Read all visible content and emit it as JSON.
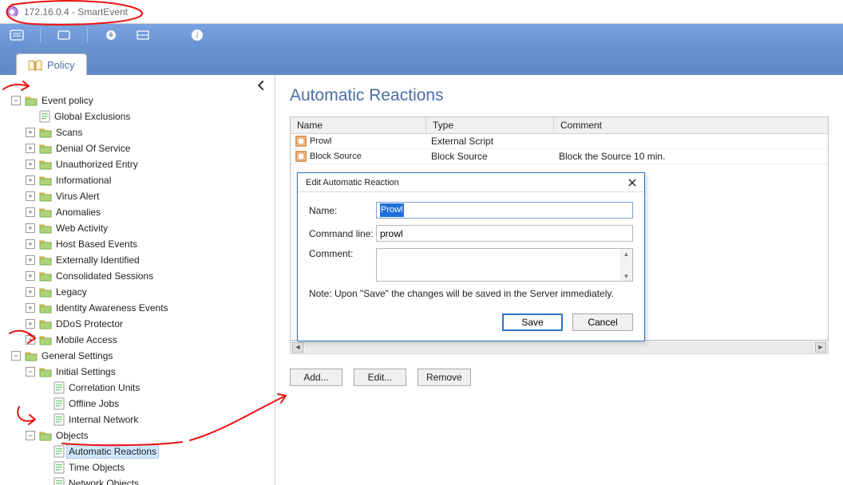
{
  "window": {
    "title": "172.16.0.4 - SmartEvent"
  },
  "tab": {
    "label": "Policy"
  },
  "tree": {
    "root": "Event policy",
    "items": [
      {
        "label": "Global Exclusions",
        "type": "doc"
      },
      {
        "label": "Scans",
        "type": "folder",
        "toggle": "+"
      },
      {
        "label": "Denial Of Service",
        "type": "folder",
        "toggle": "+"
      },
      {
        "label": "Unauthorized Entry",
        "type": "folder",
        "toggle": "+"
      },
      {
        "label": "Informational",
        "type": "folder",
        "toggle": "+"
      },
      {
        "label": "Virus Alert",
        "type": "folder",
        "toggle": "+"
      },
      {
        "label": "Anomalies",
        "type": "folder",
        "toggle": "+"
      },
      {
        "label": "Web Activity",
        "type": "folder",
        "toggle": "+"
      },
      {
        "label": "Host Based Events",
        "type": "folder",
        "toggle": "+"
      },
      {
        "label": "Externally Identified",
        "type": "folder",
        "toggle": "+"
      },
      {
        "label": "Consolidated Sessions",
        "type": "folder",
        "toggle": "+"
      },
      {
        "label": "Legacy",
        "type": "folder",
        "toggle": "+"
      },
      {
        "label": "Identity Awareness Events",
        "type": "folder",
        "toggle": "+"
      },
      {
        "label": "DDoS Protector",
        "type": "folder",
        "toggle": "+"
      },
      {
        "label": "Mobile Access",
        "type": "folder",
        "toggle": "+"
      }
    ],
    "general": "General Settings",
    "initial": "Initial Settings",
    "initial_children": [
      {
        "label": "Correlation Units"
      },
      {
        "label": "Offline Jobs"
      },
      {
        "label": "Internal Network"
      }
    ],
    "objects": "Objects",
    "objects_children": [
      {
        "label": "Automatic Reactions",
        "selected": true
      },
      {
        "label": "Time Objects"
      },
      {
        "label": "Network Objects"
      }
    ]
  },
  "page": {
    "title": "Automatic Reactions"
  },
  "grid": {
    "headers": {
      "name": "Name",
      "type": "Type",
      "comment": "Comment"
    },
    "rows": [
      {
        "name": "Prowl",
        "type": "External Script",
        "comment": ""
      },
      {
        "name": "Block Source",
        "type": "Block Source",
        "comment": "Block the Source 10 min."
      }
    ]
  },
  "buttons": {
    "add": "Add...",
    "edit": "Edit...",
    "remove": "Remove"
  },
  "dialog": {
    "title": "Edit Automatic Reaction",
    "name_label": "Name:",
    "name_value": "Prowl",
    "cmd_label": "Command line:",
    "cmd_value": "prowl",
    "comment_label": "Comment:",
    "comment_value": "",
    "note": "Note:  Upon \"Save\" the changes will be saved in the Server immediately.",
    "save": "Save",
    "cancel": "Cancel"
  }
}
